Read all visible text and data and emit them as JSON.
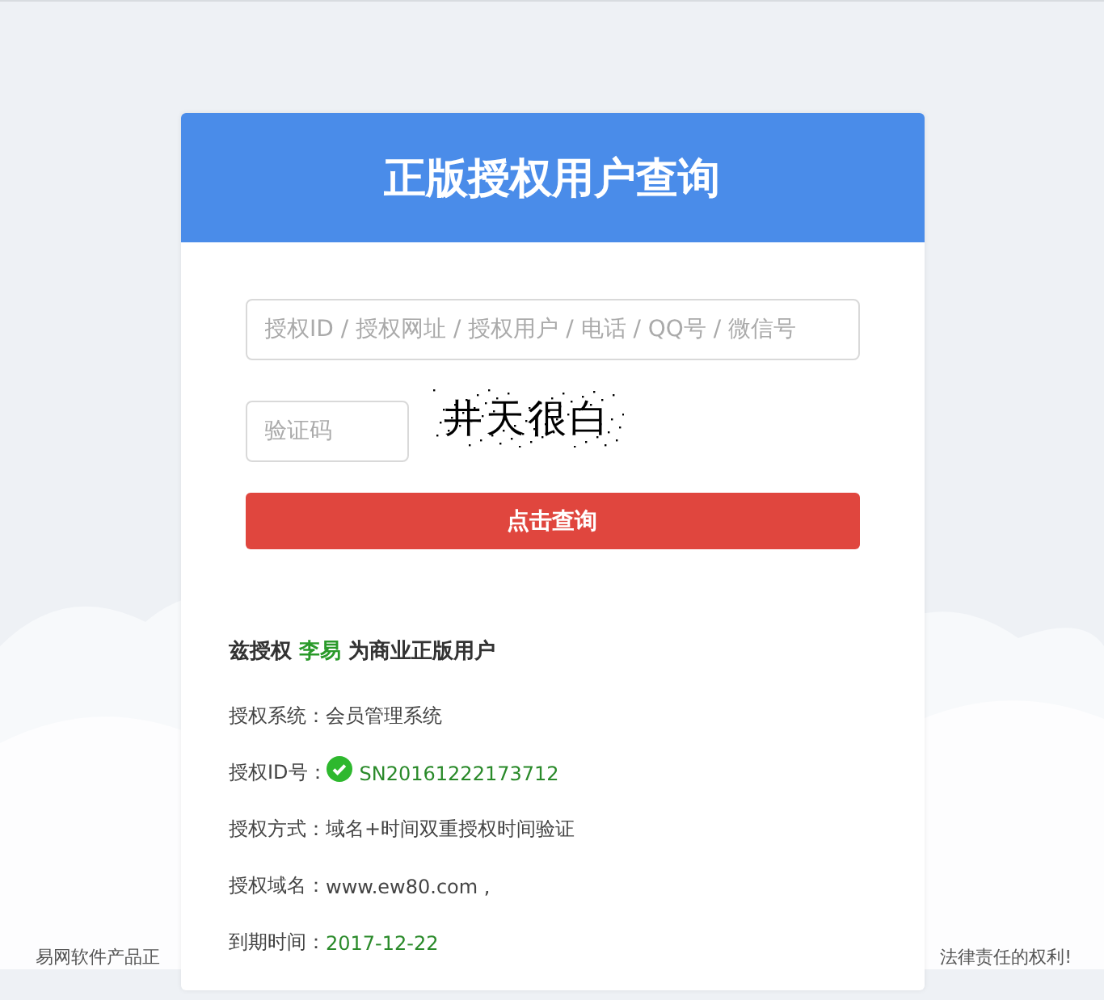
{
  "header": {
    "title": "正版授权用户查询"
  },
  "form": {
    "query_field": {
      "placeholder": "授权ID / 授权网址 / 授权用户 / 电话 / QQ号 / 微信号"
    },
    "captcha_field": {
      "placeholder": "验证码"
    },
    "captcha_image": {
      "text": "井天很白"
    },
    "submit_button": "点击查询"
  },
  "result": {
    "headline": "兹授权 **李易** 为商业正版用户",
    "rows": [
      {
        "label": "授权系统：",
        "value": "会员管理系统",
        "kind": "plain"
      },
      {
        "label": "授权ID号：",
        "value": "SN20161222173712",
        "kind": "verified"
      },
      {
        "label": "授权方式：",
        "value": "域名+时间双重授权时间验证",
        "kind": "plain"
      },
      {
        "label": "授权域名：",
        "value": "www.ew80.com ,",
        "kind": "plain"
      },
      {
        "label": "到期时间：",
        "value": "2017-12-22",
        "kind": "highlight"
      }
    ]
  },
  "footer": {
    "left": "易网软件产品正",
    "right": "法律责任的权利!"
  }
}
